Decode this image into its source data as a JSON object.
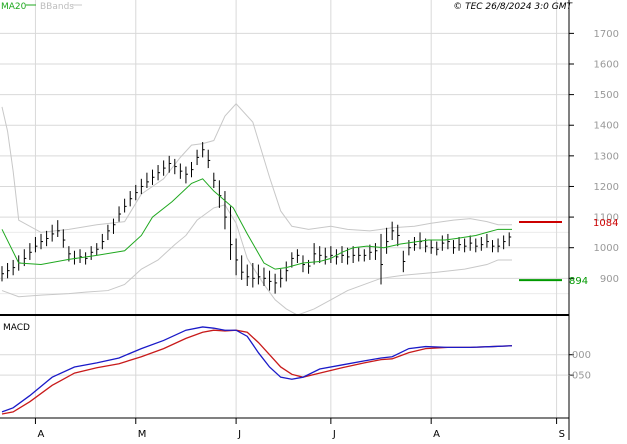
{
  "header": {
    "legend_ma20": "MA20",
    "legend_bbands": "BBands",
    "source_stamp": "© TEC 26/8/2024 3:0 GMT"
  },
  "colors": {
    "background": "#ffffff",
    "grid": "#d9d9d9",
    "price_bars": "#000000",
    "ma20": "#1fa81f",
    "bbands": "#c8c8c8",
    "macd_line": "#1a1ac8",
    "signal_line": "#c81a1a",
    "resistance": "#cc0000",
    "support": "#009900"
  },
  "chart_data": [
    {
      "type": "line",
      "title": "",
      "xlabel": "",
      "ylabel": "",
      "ylim": [
        790,
        1760
      ],
      "y_ticks": [
        900,
        1000,
        1100,
        1200,
        1300,
        1400,
        1500,
        1600,
        1700
      ],
      "y_tick_labels": [
        "900",
        "1000",
        "1100",
        "1200",
        "1300",
        "1400",
        "1500",
        "1600",
        "1700"
      ],
      "x_ticks": [
        "A",
        "M",
        "J",
        "J",
        "A",
        "S"
      ],
      "grid": true,
      "series": [
        {
          "name": "MA20",
          "kind": "line",
          "x": [
            0,
            6,
            14,
            24,
            34,
            44,
            50,
            54,
            61,
            68,
            72,
            76,
            83,
            88,
            94,
            98,
            102,
            108,
            114,
            118,
            122,
            126,
            131,
            137,
            143,
            153,
            159,
            163,
            170,
            174,
            178,
            183
          ],
          "values": [
            1060,
            950,
            945,
            962,
            975,
            990,
            1040,
            1100,
            1150,
            1210,
            1225,
            1185,
            1130,
            1045,
            950,
            930,
            935,
            950,
            955,
            965,
            985,
            1000,
            1005,
            1000,
            1012,
            1025,
            1025,
            1030,
            1040,
            1050,
            1060,
            1060
          ]
        },
        {
          "name": "BBands upper",
          "kind": "line",
          "x": [
            0,
            2,
            4,
            6,
            14,
            24,
            34,
            44,
            50,
            58,
            64,
            68,
            72,
            76,
            80,
            84,
            90,
            96,
            100,
            104,
            110,
            118,
            124,
            132,
            140,
            148,
            154,
            162,
            168,
            174,
            178,
            183
          ],
          "values": [
            1460,
            1380,
            1250,
            1090,
            1050,
            1060,
            1075,
            1085,
            1175,
            1225,
            1295,
            1335,
            1340,
            1350,
            1430,
            1470,
            1410,
            1230,
            1120,
            1070,
            1060,
            1070,
            1060,
            1055,
            1065,
            1070,
            1080,
            1090,
            1095,
            1085,
            1075,
            1075
          ]
        },
        {
          "name": "BBands lower",
          "kind": "line",
          "x": [
            0,
            6,
            14,
            24,
            30,
            38,
            44,
            50,
            56,
            62,
            66,
            70,
            76,
            80,
            84,
            88,
            94,
            98,
            102,
            106,
            112,
            118,
            124,
            130,
            136,
            144,
            150,
            156,
            166,
            174,
            178,
            183
          ],
          "values": [
            860,
            840,
            845,
            850,
            855,
            860,
            880,
            930,
            960,
            1010,
            1040,
            1090,
            1130,
            1140,
            1080,
            965,
            880,
            830,
            800,
            780,
            800,
            830,
            860,
            880,
            900,
            910,
            915,
            920,
            930,
            945,
            960,
            960
          ]
        },
        {
          "name": "Resistance",
          "kind": "level",
          "values": [
            1084
          ],
          "label": "1084"
        },
        {
          "name": "Support",
          "kind": "level",
          "values": [
            894
          ],
          "label": "894"
        },
        {
          "name": "Price",
          "kind": "ohlc",
          "x": [
            0,
            2,
            4,
            6,
            8,
            10,
            12,
            14,
            16,
            18,
            20,
            22,
            24,
            26,
            28,
            30,
            32,
            34,
            36,
            38,
            40,
            42,
            44,
            46,
            48,
            50,
            52,
            54,
            56,
            58,
            60,
            62,
            64,
            66,
            68,
            70,
            72,
            74,
            76,
            78,
            80,
            82,
            84,
            86,
            88,
            90,
            92,
            94,
            96,
            98,
            100,
            102,
            104,
            106,
            108,
            110,
            112,
            114,
            116,
            118,
            120,
            122,
            124,
            126,
            128,
            130,
            132,
            134,
            136,
            138,
            140,
            142,
            144,
            146,
            148,
            150,
            152,
            154,
            156,
            158,
            160,
            162,
            164,
            166,
            168,
            170,
            172,
            174,
            176,
            178,
            180,
            182
          ],
          "high": [
            940,
            950,
            960,
            975,
            995,
            1015,
            1035,
            1045,
            1055,
            1075,
            1090,
            1060,
            1005,
            990,
            995,
            985,
            1005,
            1015,
            1045,
            1075,
            1095,
            1135,
            1160,
            1185,
            1205,
            1225,
            1245,
            1255,
            1270,
            1285,
            1300,
            1290,
            1275,
            1265,
            1280,
            1320,
            1345,
            1320,
            1245,
            1220,
            1185,
            1135,
            1030,
            975,
            945,
            950,
            945,
            935,
            925,
            915,
            930,
            955,
            985,
            995,
            975,
            960,
            1015,
            1005,
            1000,
            1005,
            995,
            1005,
            1000,
            1005,
            1000,
            995,
            1010,
            1015,
            1045,
            1065,
            1085,
            1075,
            990,
            1025,
            1035,
            1050,
            1030,
            1025,
            1020,
            1040,
            1045,
            1025,
            1035,
            1030,
            1040,
            1030,
            1035,
            1045,
            1025,
            1030,
            1040,
            1050
          ],
          "low": [
            890,
            900,
            910,
            925,
            940,
            960,
            985,
            995,
            1005,
            1020,
            1035,
            1000,
            955,
            945,
            950,
            945,
            960,
            975,
            995,
            1025,
            1045,
            1085,
            1115,
            1135,
            1155,
            1175,
            1195,
            1205,
            1220,
            1235,
            1245,
            1240,
            1225,
            1210,
            1230,
            1270,
            1295,
            1260,
            1195,
            1130,
            1060,
            960,
            910,
            895,
            875,
            870,
            880,
            875,
            860,
            850,
            870,
            890,
            935,
            950,
            920,
            915,
            945,
            950,
            945,
            950,
            945,
            950,
            945,
            950,
            955,
            955,
            960,
            960,
            880,
            980,
            1025,
            1005,
            920,
            975,
            990,
            995,
            985,
            980,
            975,
            990,
            995,
            980,
            990,
            985,
            990,
            985,
            990,
            1000,
            985,
            985,
            995,
            1005
          ],
          "close": [
            915,
            925,
            935,
            950,
            965,
            985,
            1005,
            1020,
            1030,
            1045,
            1055,
            1025,
            980,
            965,
            970,
            965,
            985,
            995,
            1020,
            1055,
            1075,
            1110,
            1135,
            1160,
            1180,
            1200,
            1215,
            1230,
            1245,
            1260,
            1275,
            1265,
            1250,
            1240,
            1255,
            1295,
            1320,
            1285,
            1220,
            1170,
            1100,
            1010,
            960,
            920,
            905,
            900,
            905,
            900,
            890,
            885,
            900,
            925,
            965,
            975,
            945,
            940,
            980,
            975,
            970,
            975,
            970,
            975,
            970,
            975,
            975,
            975,
            985,
            990,
            945,
            1020,
            1055,
            1040,
            955,
            1000,
            1010,
            1020,
            1005,
            1000,
            995,
            1015,
            1020,
            1000,
            1010,
            1005,
            1015,
            1005,
            1010,
            1020,
            1005,
            1005,
            1020,
            1035
          ]
        }
      ]
    },
    {
      "type": "line",
      "title": "MACD",
      "xlabel": "",
      "ylabel": "",
      "ylim": [
        -150,
        85
      ],
      "y_ticks": [
        0,
        -50
      ],
      "y_tick_labels": [
        "000",
        "-050"
      ],
      "x_ticks": [
        "A",
        "M",
        "J",
        "J",
        "A",
        "S"
      ],
      "grid": true,
      "series": [
        {
          "name": "MACD",
          "kind": "line",
          "x": [
            0,
            4,
            10,
            18,
            26,
            34,
            42,
            50,
            58,
            66,
            72,
            76,
            80,
            84,
            88,
            92,
            96,
            100,
            104,
            108,
            114,
            122,
            130,
            136,
            140,
            146,
            152,
            160,
            168,
            176,
            183
          ],
          "values": [
            -140,
            -130,
            -100,
            -55,
            -30,
            -20,
            -8,
            15,
            35,
            60,
            68,
            65,
            60,
            60,
            45,
            5,
            -30,
            -55,
            -60,
            -55,
            -35,
            -25,
            -15,
            -8,
            -5,
            15,
            20,
            18,
            18,
            20,
            22
          ]
        },
        {
          "name": "Signal",
          "kind": "line",
          "x": [
            0,
            4,
            10,
            18,
            26,
            34,
            42,
            50,
            58,
            66,
            72,
            76,
            80,
            84,
            88,
            92,
            96,
            100,
            104,
            108,
            114,
            122,
            130,
            136,
            140,
            146,
            152,
            160,
            168,
            176,
            183
          ],
          "values": [
            -145,
            -140,
            -115,
            -75,
            -45,
            -32,
            -22,
            -5,
            15,
            40,
            55,
            60,
            58,
            60,
            55,
            30,
            0,
            -30,
            -48,
            -55,
            -45,
            -32,
            -20,
            -12,
            -10,
            5,
            15,
            18,
            18,
            20,
            22
          ]
        }
      ]
    }
  ]
}
